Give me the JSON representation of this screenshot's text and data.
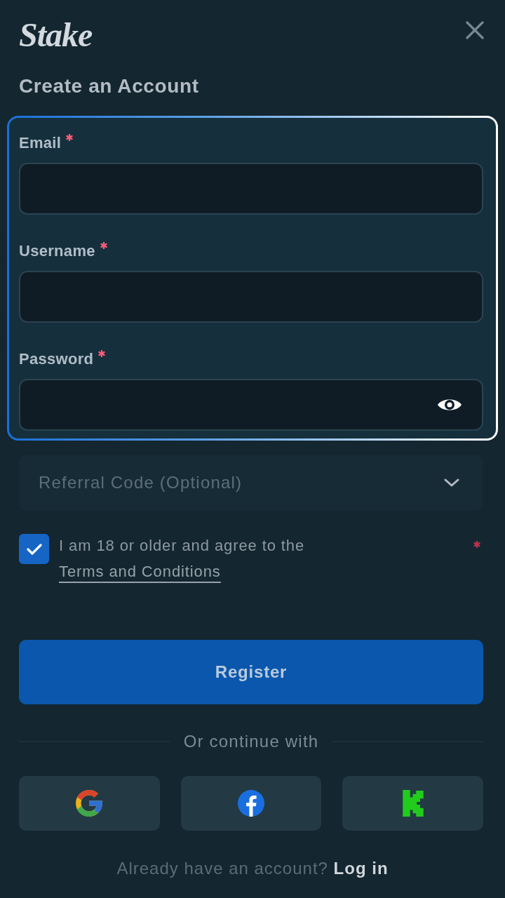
{
  "header": {
    "logo": "Stake",
    "title": "Create an Account"
  },
  "form": {
    "highlighted": true,
    "fields": [
      {
        "label": "Email",
        "required": true,
        "kind": "text"
      },
      {
        "label": "Username",
        "required": true,
        "kind": "text"
      },
      {
        "label": "Password",
        "required": true,
        "kind": "password"
      }
    ]
  },
  "referral": {
    "label": "Referral Code (Optional)",
    "expanded": false
  },
  "agreement": {
    "text": "I am 18 or older and agree to the",
    "link": "Terms and Conditions",
    "checked": true,
    "required": true
  },
  "register_button": {
    "label": "Register"
  },
  "divider": {
    "text": "Or continue with"
  },
  "social_buttons": [
    {
      "kind": "google"
    },
    {
      "kind": "facebook"
    },
    {
      "kind": "kick"
    }
  ],
  "footer": {
    "text": "Already have an account?",
    "link": "Log in"
  }
}
